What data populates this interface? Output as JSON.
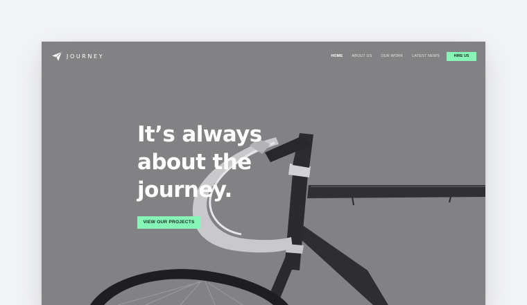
{
  "brand": {
    "name": "JOURNEY",
    "icon": "paper-plane-icon"
  },
  "nav": {
    "items": [
      {
        "label": "HOME",
        "active": true
      },
      {
        "label": "ABOUT US",
        "active": false
      },
      {
        "label": "OUR WORK",
        "active": false
      },
      {
        "label": "LATEST NEWS",
        "active": false
      }
    ],
    "cta_label": "HIRE US"
  },
  "hero": {
    "title": "It’s always about the journey.",
    "button_label": "VIEW OUR PROJECTS",
    "background_image": "bicycle-image"
  },
  "colors": {
    "page_background": "#f2f3f5",
    "hero_background": "#828284",
    "accent": "#86f5b5",
    "text": "#ffffff"
  }
}
